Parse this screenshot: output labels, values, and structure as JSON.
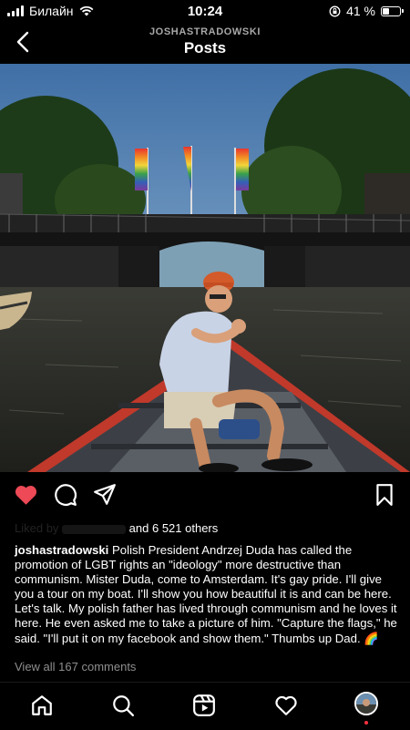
{
  "status_bar": {
    "carrier": "Билайн",
    "time": "10:24",
    "battery": "41 %",
    "battery_level": 0.41
  },
  "header": {
    "username": "JOSHASTRADOWSKI",
    "title": "Posts"
  },
  "post": {
    "liked_by_blurred": "Liked by ",
    "liked_suffix": "and 6 521 others",
    "author": "joshastradowski",
    "caption": "Polish President Andrzej Duda has called the promotion of LGBT rights an \"ideology\" more destructive than communism. Mister Duda, come to Amsterdam. It's gay pride. I'll give you a tour on my boat. I'll show you how beautiful it is and can be here. Let's talk. My polish father has lived through communism and he loves it here. He even asked me to take a picture of him. \"Capture the flags,\" he said. \"I'll put it on my facebook and show them.\" Thumbs up Dad. 🌈",
    "view_comments": "View all 167 comments"
  },
  "icons": {
    "back": "chevron-left-icon",
    "like": "heart-filled-icon",
    "comment": "comment-icon",
    "share": "paper-plane-icon",
    "save": "bookmark-icon",
    "tabs": [
      "home-icon",
      "search-icon",
      "reels-icon",
      "activity-heart-icon",
      "profile-avatar"
    ]
  },
  "colors": {
    "like": "#ed4956",
    "notification_dot": "#ff3040",
    "muted_text": "#8e8e8e"
  }
}
